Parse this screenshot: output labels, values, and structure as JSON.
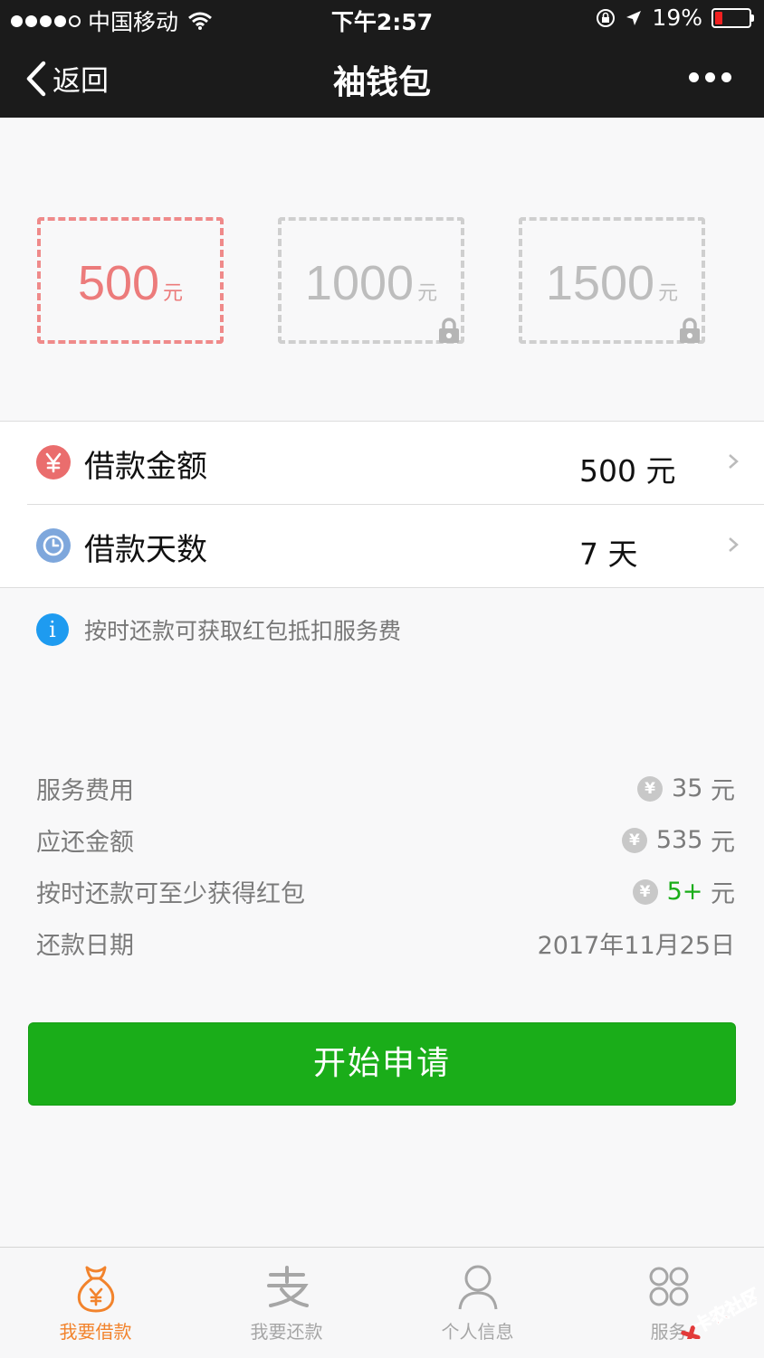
{
  "status_bar": {
    "carrier": "中国移动",
    "time": "下午2:57",
    "battery": "19%",
    "battery_color": "#f02020"
  },
  "nav": {
    "back_label": "返回",
    "title": "袖钱包"
  },
  "amount_options": [
    {
      "value": "500",
      "unit": "元",
      "selected": true,
      "locked": false
    },
    {
      "value": "1000",
      "unit": "元",
      "selected": false,
      "locked": true
    },
    {
      "value": "1500",
      "unit": "元",
      "selected": false,
      "locked": true
    }
  ],
  "loan": {
    "amount_label": "借款金额",
    "amount_value": "500 元",
    "days_label": "借款天数",
    "days_value": "7 天"
  },
  "tip": "按时还款可获取红包抵扣服务费",
  "details": [
    {
      "label": "服务费用",
      "value": "35",
      "unit": "元",
      "yen_icon": true
    },
    {
      "label": "应还金额",
      "value": "535",
      "unit": "元",
      "yen_icon": true
    },
    {
      "label": "按时还款可至少获得红包",
      "value": "5+",
      "unit": "元",
      "yen_icon": true,
      "highlight_color": "#1aad19"
    },
    {
      "label": "还款日期",
      "value": "2017年11月25日",
      "unit": "",
      "yen_icon": false
    }
  ],
  "apply_button": "开始申请",
  "tabs": [
    {
      "label": "我要借款",
      "icon": "money-bag-icon",
      "active": true
    },
    {
      "label": "我要还款",
      "icon": "alipay-icon",
      "active": false
    },
    {
      "label": "个人信息",
      "icon": "person-icon",
      "active": false
    },
    {
      "label": "服务",
      "icon": "grid-icon",
      "active": false
    }
  ],
  "watermark": "卡农社区",
  "colors": {
    "accent_green": "#1aad19",
    "selected_red": "#ec7b7b",
    "active_tab_orange": "#f2832c",
    "nav_bg": "#1b1b1b"
  }
}
